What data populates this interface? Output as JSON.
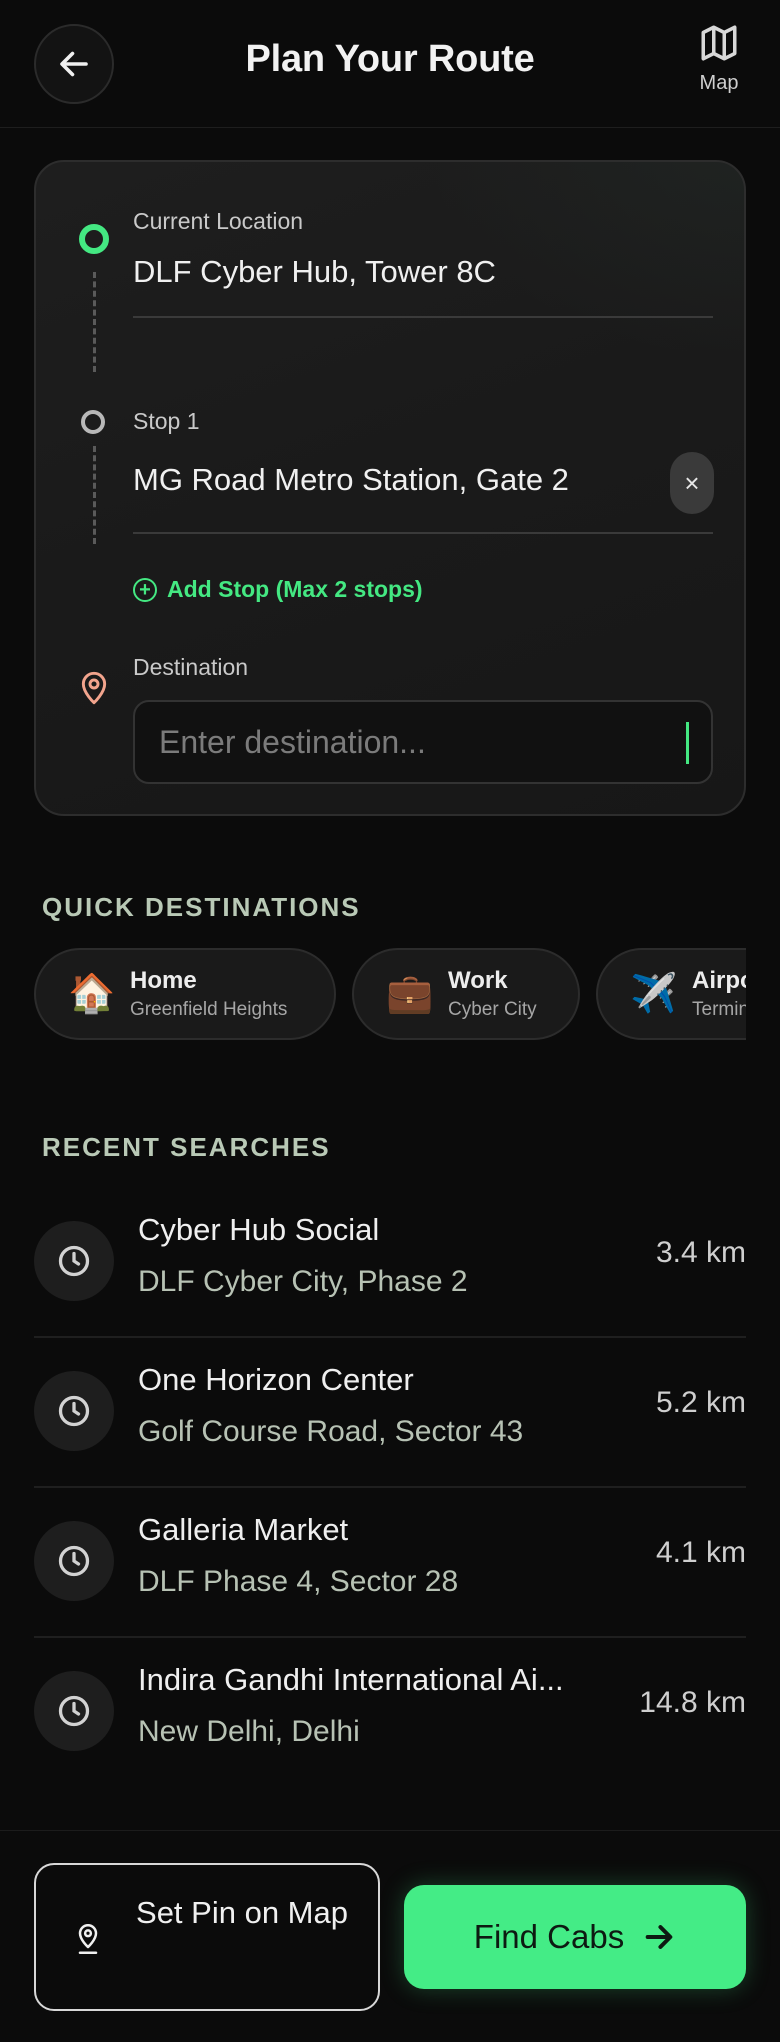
{
  "header": {
    "title": "Plan Your Route",
    "map_label": "Map"
  },
  "route": {
    "current_label": "Current Location",
    "current_value": "DLF Cyber Hub, Tower 8C",
    "stop_label": "Stop 1",
    "stop_value": "MG Road Metro Station, Gate 2",
    "clear_glyph": "×",
    "add_stop_label": "Add Stop (Max 2 stops)",
    "destination_label": "Destination",
    "destination_value": "",
    "destination_placeholder": "Enter destination..."
  },
  "quick": {
    "title": "QUICK DESTINATIONS",
    "items": [
      {
        "icon": "🏠",
        "icon_name": "home-icon",
        "title": "Home",
        "subtitle": "Greenfield Heights"
      },
      {
        "icon": "💼",
        "icon_name": "briefcase-icon",
        "title": "Work",
        "subtitle": "Cyber City"
      },
      {
        "icon": "✈️",
        "icon_name": "airplane-icon",
        "title": "Airport",
        "subtitle": "Terminal"
      }
    ]
  },
  "recent": {
    "title": "RECENT SEARCHES",
    "items": [
      {
        "title": "Cyber Hub Social",
        "subtitle": "DLF Cyber City, Phase 2",
        "distance": "3.4 km"
      },
      {
        "title": "One Horizon Center",
        "subtitle": "Golf Course Road, Sector 43",
        "distance": "5.2 km"
      },
      {
        "title": "Galleria Market",
        "subtitle": "DLF Phase 4, Sector 28",
        "distance": "4.1 km"
      },
      {
        "title": "Indira Gandhi International Ai...",
        "subtitle": "New Delhi, Delhi",
        "distance": "14.8 km"
      }
    ]
  },
  "footer": {
    "set_pin_label": "Set Pin on Map",
    "find_cabs_label": "Find Cabs"
  },
  "colors": {
    "accent": "#44ec86",
    "background": "#0b0b0b",
    "card": "#1a1a1a",
    "destination_pin": "#f2a48d"
  }
}
